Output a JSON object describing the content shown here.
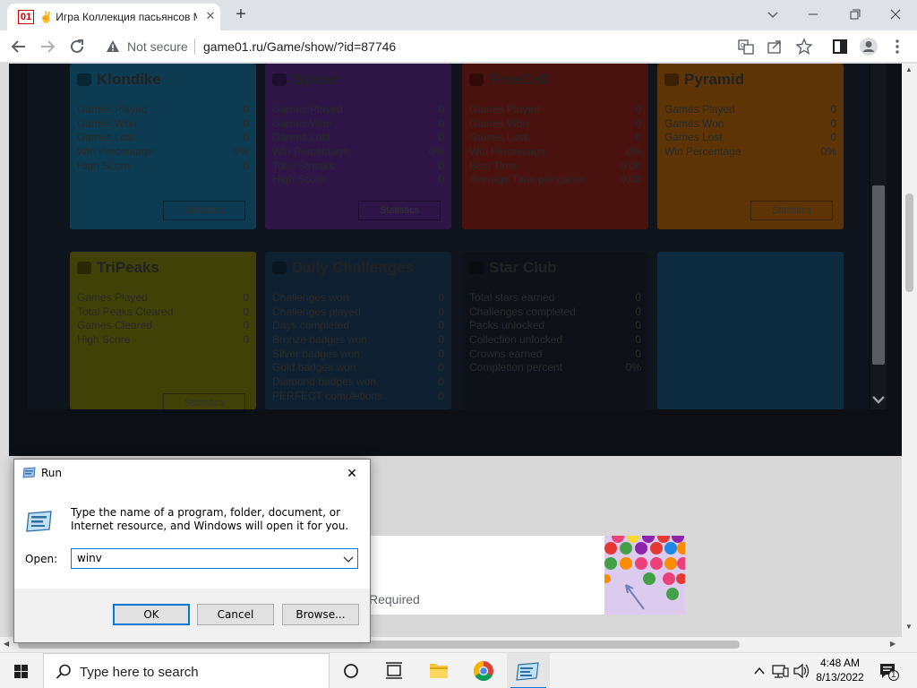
{
  "browser": {
    "tab": {
      "favicon_text": "01",
      "title": "✌ Игра Коллекция пасьянсов Microsoft",
      "close_glyph": "✕"
    },
    "new_tab_glyph": "+",
    "window_controls": {
      "minimize": "—",
      "restore": "❐",
      "close": "✕"
    },
    "security_label": "Not secure",
    "url": "game01.ru/Game/show/?id=87746"
  },
  "game": {
    "cards": [
      {
        "title": "Klondike",
        "stats": [
          [
            "Games Played",
            "0"
          ],
          [
            "Games Won",
            "0"
          ],
          [
            "Games Lost",
            "0"
          ],
          [
            "Win Percentage",
            "0%"
          ],
          [
            "High Score",
            "0"
          ]
        ],
        "button": "Statistics"
      },
      {
        "title": "Spider",
        "stats": [
          [
            "Games Played",
            "0"
          ],
          [
            "Games Won",
            "0"
          ],
          [
            "Games Lost",
            "0"
          ],
          [
            "Win Percentage",
            "0%"
          ],
          [
            "Total Streaks",
            "0"
          ],
          [
            "High Score",
            "0"
          ]
        ],
        "button": "Statistics"
      },
      {
        "title": "FreeCell",
        "stats": [
          [
            "Games Played",
            "0"
          ],
          [
            "Games Won",
            "0"
          ],
          [
            "Games Lost",
            "0"
          ],
          [
            "Win Percentage",
            "0%"
          ],
          [
            "Best Time",
            "0:00"
          ],
          [
            "Average Time per game",
            "0:00"
          ]
        ],
        "button": ""
      },
      {
        "title": "Pyramid",
        "stats": [
          [
            "Games Played",
            "0"
          ],
          [
            "Games Won",
            "0"
          ],
          [
            "Games Lost",
            "0"
          ],
          [
            "Win Percentage",
            "0%"
          ]
        ],
        "button": "Statistics"
      },
      {
        "title": "TriPeaks",
        "stats": [
          [
            "Games Played",
            "0"
          ],
          [
            "Total Peaks Cleared",
            "0"
          ],
          [
            "Games Cleared",
            "0"
          ],
          [
            "High Score",
            "0"
          ]
        ],
        "button": "Statistics"
      },
      {
        "title": "Daily Challenges",
        "stats": [
          [
            "Challenges won",
            "0"
          ],
          [
            "Challenges played",
            "0"
          ],
          [
            "Days completed",
            "0"
          ],
          [
            "Bronze badges won",
            "0"
          ],
          [
            "Silver badges won",
            "0"
          ],
          [
            "Gold badges won",
            "0"
          ],
          [
            "Diamond badges won",
            "0"
          ],
          [
            "PERFECT completions",
            "0"
          ]
        ],
        "button": ""
      },
      {
        "title": "Star Club",
        "stats": [
          [
            "Total stars earned",
            "0"
          ],
          [
            "Challenges completed",
            "0"
          ],
          [
            "Packs unlocked",
            "0"
          ],
          [
            "Collection unlocked",
            "0"
          ],
          [
            "Crowns earned",
            "0"
          ],
          [
            "Completion percent",
            "0%"
          ]
        ],
        "button": ""
      }
    ]
  },
  "ad": {
    "text": "Required"
  },
  "run_dialog": {
    "title": "Run",
    "close_glyph": "✕",
    "description": "Type the name of a program, folder, document, or Internet resource, and Windows will open it for you.",
    "open_label": "Open:",
    "open_value": "winv",
    "buttons": {
      "ok": "OK",
      "cancel": "Cancel",
      "browse": "Browse..."
    }
  },
  "taskbar": {
    "search_placeholder": "Type here to search",
    "time": "4:48 AM",
    "date": "8/13/2022",
    "notification_count": "1"
  },
  "colors": {
    "accent": "#0078d7",
    "chrome_bg": "#dee1e6",
    "favicon_red": "#cc0000"
  }
}
